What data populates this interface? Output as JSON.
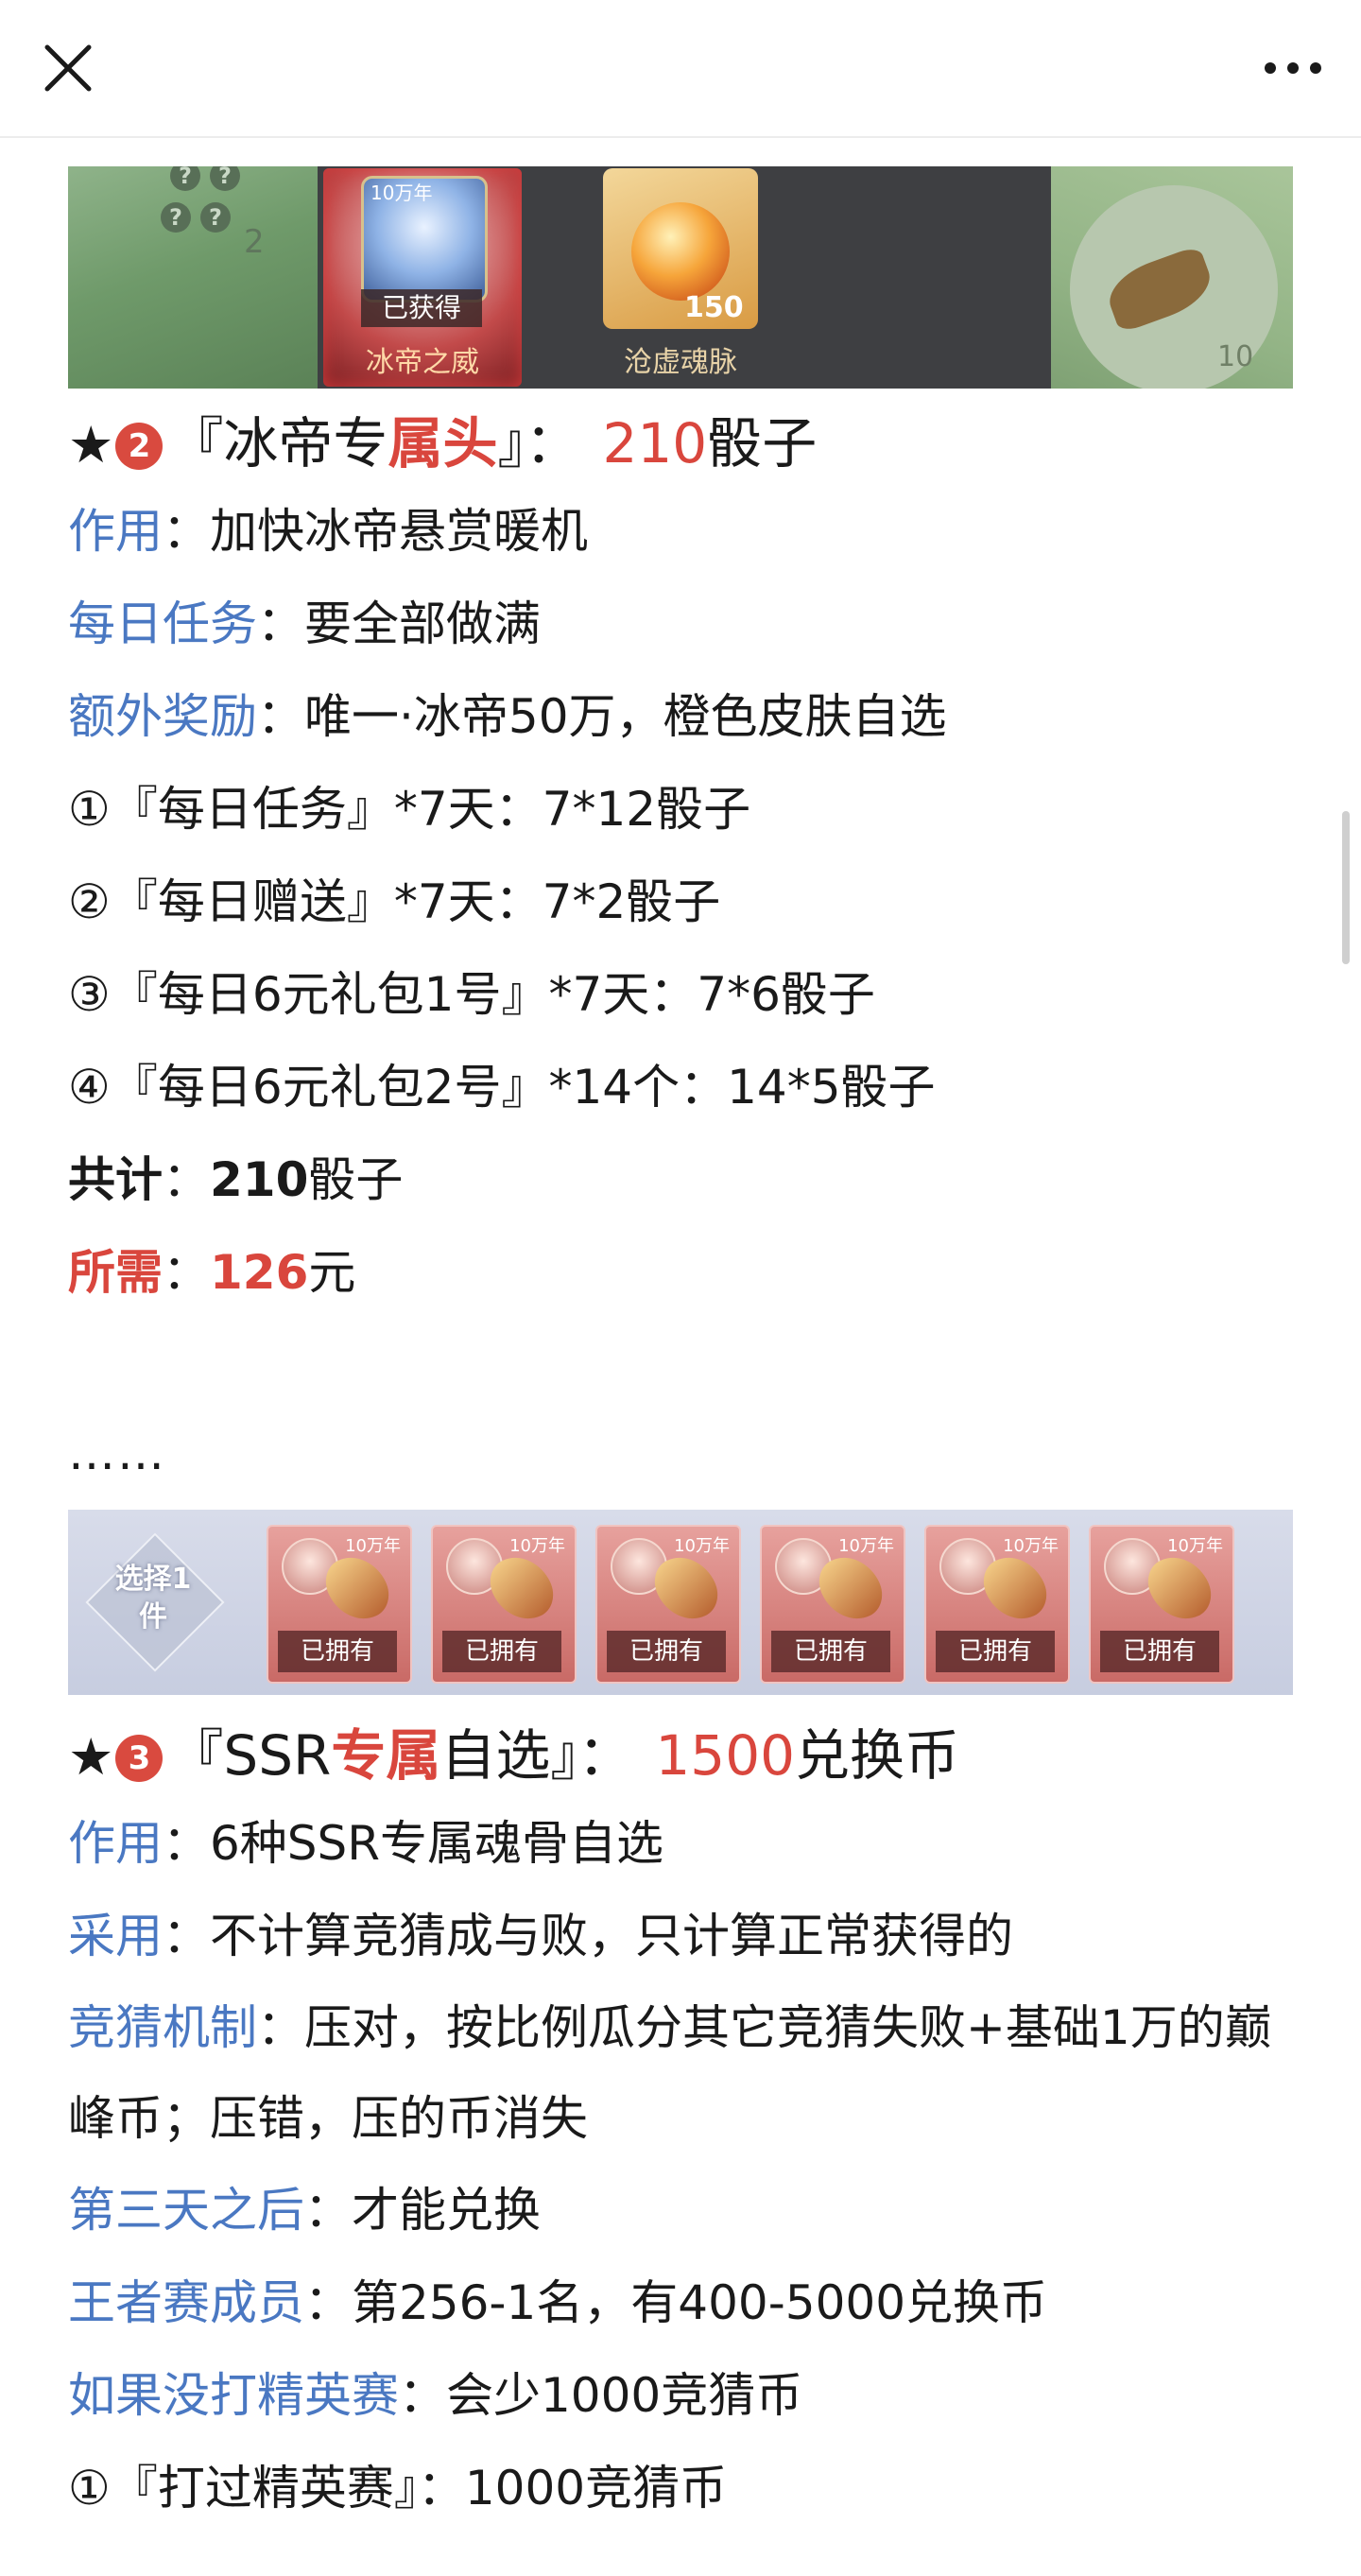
{
  "toolbar": {
    "close_icon": "close-icon",
    "more_icon": "more-icon"
  },
  "banner1": {
    "left_num": "2",
    "card1": {
      "tag": "10万年",
      "status": "已获得",
      "name": "冰帝之威"
    },
    "card2": {
      "count": "150",
      "name": "沧虚魂脉"
    },
    "right_num": "10"
  },
  "section2": {
    "star": "★",
    "badge": "2",
    "title_pre": "『冰帝专",
    "title_red": "属头",
    "title_post": "』：",
    "price_num": "210",
    "price_unit": "骰子",
    "effect_label": "作用",
    "effect_value": "：加快冰帝悬赏暖机",
    "daily_label": "每日任务",
    "daily_value": "：要全部做满",
    "extra_label": "额外奖励",
    "extra_value": "：唯一·冰帝50万，橙色皮肤自选",
    "items": [
      "①『每日任务』*7天：7*12骰子",
      "②『每日赠送』*7天：7*2骰子",
      "③『每日6元礼包1号』*7天：7*6骰子",
      "④『每日6元礼包2号』*14个：14*5骰子"
    ],
    "total_label": "共计",
    "total_sep": "：",
    "total_num": "210",
    "total_unit": "骰子",
    "need_label": "所需",
    "need_sep": "：",
    "need_num": "126",
    "need_unit": "元"
  },
  "ellipsis": "……",
  "banner2": {
    "select_text": "选择1件",
    "card_tag": "10万年",
    "card_status": "已拥有"
  },
  "section3": {
    "star": "★",
    "badge": "3",
    "title_pre": "『SSR",
    "title_red": "专属",
    "title_post": "自选』：",
    "price_num": "1500",
    "price_unit": "兑换币",
    "effect_label": "作用",
    "effect_value": "：6种SSR专属魂骨自选",
    "adopt_label": "采用",
    "adopt_value": "：不计算竞猜成与败，只计算正常获得的",
    "guess_label": "竞猜机制",
    "guess_value": "：压对，按比例瓜分其它竞猜失败+基础1万的巅峰币；压错，压的币消失",
    "day3_label": "第三天之后",
    "day3_value": "：才能兑换",
    "king_label": "王者赛成员",
    "king_value": "：第256-1名，有400-5000兑换币",
    "elite_label": "如果没打精英赛",
    "elite_value": "：会少1000竞猜币",
    "item1": "①『打过精英赛』：1000竞猜币"
  }
}
